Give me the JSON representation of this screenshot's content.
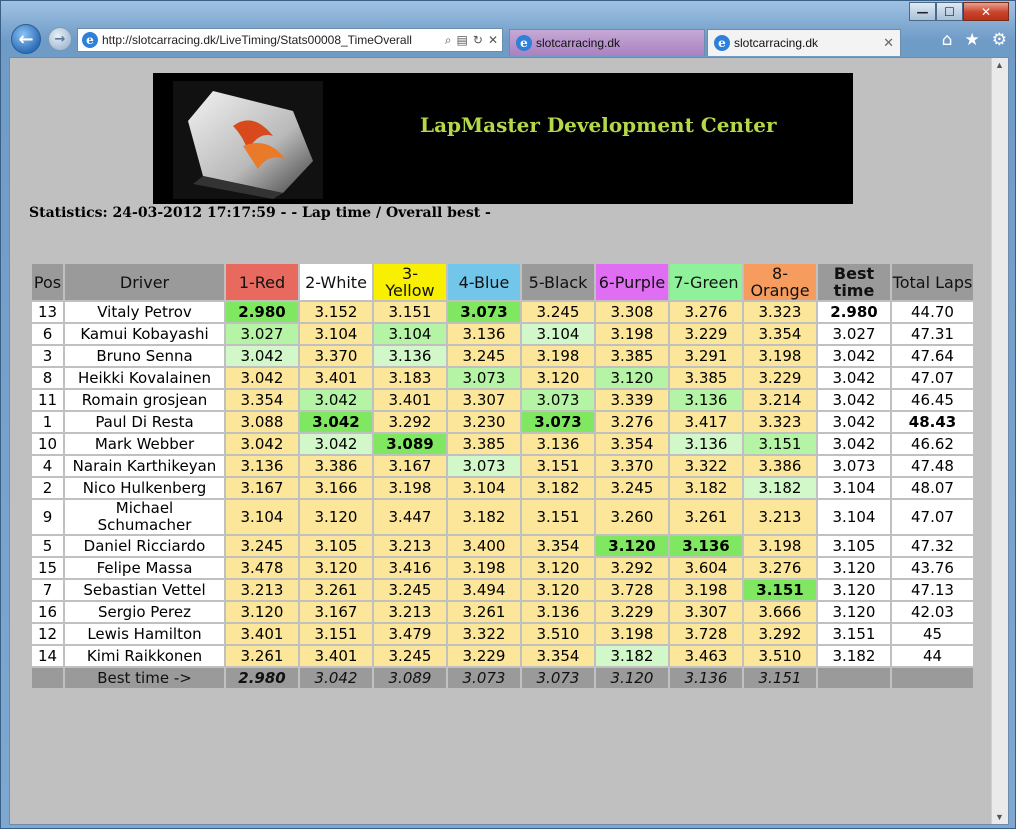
{
  "browser": {
    "url": "http://slotcarracing.dk/LiveTiming/Stats00008_TimeOverall",
    "tabs": [
      {
        "label": "slotcarracing.dk"
      },
      {
        "label": "slotcarracing.dk"
      }
    ],
    "window_buttons": {
      "minimize": "—",
      "maximize": "☐",
      "close": "✕"
    }
  },
  "banner": {
    "title": "LapMaster Development Center"
  },
  "stats_line": "Statistics: 24-03-2012 17:17:59 - - Lap time / Overall best -",
  "table": {
    "headers": {
      "pos": "Pos",
      "driver": "Driver",
      "lanes": [
        "1-Red",
        "2-White",
        "3-\nYellow",
        "4-Blue",
        "5-Black",
        "6-Purple",
        "7-Green",
        "8-\nOrange"
      ],
      "best": "Best time",
      "total": "Total Laps"
    },
    "lane_colors": [
      "#e86a5e",
      "#ffffff",
      "#f8f000",
      "#72c6ea",
      "#9a9a9a",
      "#e06ef2",
      "#8ff29a",
      "#f59c5e"
    ],
    "rows": [
      {
        "pos": "13",
        "driver": "Vitaly Petrov",
        "laps": [
          "2.980",
          "3.152",
          "3.151",
          "3.073",
          "3.245",
          "3.308",
          "3.276",
          "3.323"
        ],
        "cls": [
          "bg",
          "y",
          "y",
          "bg",
          "y",
          "y",
          "y",
          "y"
        ],
        "best": "2.980",
        "best_bold": true,
        "total": "44.70",
        "total_bold": false
      },
      {
        "pos": "6",
        "driver": "Kamui Kobayashi",
        "laps": [
          "3.027",
          "3.104",
          "3.104",
          "3.136",
          "3.104",
          "3.198",
          "3.229",
          "3.354"
        ],
        "cls": [
          "mg",
          "y",
          "mg",
          "y",
          "lg",
          "y",
          "y",
          "y"
        ],
        "best": "3.027",
        "best_bold": false,
        "total": "47.31",
        "total_bold": false
      },
      {
        "pos": "3",
        "driver": "Bruno Senna",
        "laps": [
          "3.042",
          "3.370",
          "3.136",
          "3.245",
          "3.198",
          "3.385",
          "3.291",
          "3.198"
        ],
        "cls": [
          "lg",
          "y",
          "lg",
          "y",
          "y",
          "y",
          "y",
          "y"
        ],
        "best": "3.042",
        "best_bold": false,
        "total": "47.64",
        "total_bold": false
      },
      {
        "pos": "8",
        "driver": "Heikki Kovalainen",
        "laps": [
          "3.042",
          "3.401",
          "3.183",
          "3.073",
          "3.120",
          "3.120",
          "3.385",
          "3.229"
        ],
        "cls": [
          "y",
          "y",
          "y",
          "mg",
          "y",
          "mg",
          "y",
          "y"
        ],
        "best": "3.042",
        "best_bold": false,
        "total": "47.07",
        "total_bold": false
      },
      {
        "pos": "11",
        "driver": "Romain grosjean",
        "laps": [
          "3.354",
          "3.042",
          "3.401",
          "3.307",
          "3.073",
          "3.339",
          "3.136",
          "3.214"
        ],
        "cls": [
          "y",
          "mg",
          "y",
          "y",
          "mg",
          "y",
          "mg",
          "y"
        ],
        "best": "3.042",
        "best_bold": false,
        "total": "46.45",
        "total_bold": false
      },
      {
        "pos": "1",
        "driver": "Paul Di Resta",
        "laps": [
          "3.088",
          "3.042",
          "3.292",
          "3.230",
          "3.073",
          "3.276",
          "3.417",
          "3.323"
        ],
        "cls": [
          "y",
          "bg",
          "y",
          "y",
          "bg",
          "y",
          "y",
          "y"
        ],
        "best": "3.042",
        "best_bold": false,
        "total": "48.43",
        "total_bold": true
      },
      {
        "pos": "10",
        "driver": "Mark Webber",
        "laps": [
          "3.042",
          "3.042",
          "3.089",
          "3.385",
          "3.136",
          "3.354",
          "3.136",
          "3.151"
        ],
        "cls": [
          "y",
          "lg",
          "bg",
          "y",
          "y",
          "y",
          "lg",
          "mg"
        ],
        "best": "3.042",
        "best_bold": false,
        "total": "46.62",
        "total_bold": false
      },
      {
        "pos": "4",
        "driver": "Narain Karthikeyan",
        "laps": [
          "3.136",
          "3.386",
          "3.167",
          "3.073",
          "3.151",
          "3.370",
          "3.322",
          "3.386"
        ],
        "cls": [
          "y",
          "y",
          "y",
          "lg",
          "y",
          "y",
          "y",
          "y"
        ],
        "best": "3.073",
        "best_bold": false,
        "total": "47.48",
        "total_bold": false
      },
      {
        "pos": "2",
        "driver": "Nico Hulkenberg",
        "laps": [
          "3.167",
          "3.166",
          "3.198",
          "3.104",
          "3.182",
          "3.245",
          "3.182",
          "3.182"
        ],
        "cls": [
          "y",
          "y",
          "y",
          "y",
          "y",
          "y",
          "y",
          "lg"
        ],
        "best": "3.104",
        "best_bold": false,
        "total": "48.07",
        "total_bold": false
      },
      {
        "pos": "9",
        "driver": "Michael\nSchumacher",
        "laps": [
          "3.104",
          "3.120",
          "3.447",
          "3.182",
          "3.151",
          "3.260",
          "3.261",
          "3.213"
        ],
        "cls": [
          "y",
          "y",
          "y",
          "y",
          "y",
          "y",
          "y",
          "y"
        ],
        "best": "3.104",
        "best_bold": false,
        "total": "47.07",
        "total_bold": false
      },
      {
        "pos": "5",
        "driver": "Daniel Ricciardo",
        "laps": [
          "3.245",
          "3.105",
          "3.213",
          "3.400",
          "3.354",
          "3.120",
          "3.136",
          "3.198"
        ],
        "cls": [
          "y",
          "y",
          "y",
          "y",
          "y",
          "bg",
          "bg",
          "y"
        ],
        "best": "3.105",
        "best_bold": false,
        "total": "47.32",
        "total_bold": false
      },
      {
        "pos": "15",
        "driver": "Felipe Massa",
        "laps": [
          "3.478",
          "3.120",
          "3.416",
          "3.198",
          "3.120",
          "3.292",
          "3.604",
          "3.276"
        ],
        "cls": [
          "y",
          "y",
          "y",
          "y",
          "y",
          "y",
          "y",
          "y"
        ],
        "best": "3.120",
        "best_bold": false,
        "total": "43.76",
        "total_bold": false
      },
      {
        "pos": "7",
        "driver": "Sebastian Vettel",
        "laps": [
          "3.213",
          "3.261",
          "3.245",
          "3.494",
          "3.120",
          "3.728",
          "3.198",
          "3.151"
        ],
        "cls": [
          "y",
          "y",
          "y",
          "y",
          "y",
          "y",
          "y",
          "bg"
        ],
        "best": "3.120",
        "best_bold": false,
        "total": "47.13",
        "total_bold": false
      },
      {
        "pos": "16",
        "driver": "Sergio Perez",
        "laps": [
          "3.120",
          "3.167",
          "3.213",
          "3.261",
          "3.136",
          "3.229",
          "3.307",
          "3.666"
        ],
        "cls": [
          "y",
          "y",
          "y",
          "y",
          "y",
          "y",
          "y",
          "y"
        ],
        "best": "3.120",
        "best_bold": false,
        "total": "42.03",
        "total_bold": false
      },
      {
        "pos": "12",
        "driver": "Lewis Hamilton",
        "laps": [
          "3.401",
          "3.151",
          "3.479",
          "3.322",
          "3.510",
          "3.198",
          "3.728",
          "3.292"
        ],
        "cls": [
          "y",
          "y",
          "y",
          "y",
          "y",
          "y",
          "y",
          "y"
        ],
        "best": "3.151",
        "best_bold": false,
        "total": "45",
        "total_bold": false
      },
      {
        "pos": "14",
        "driver": "Kimi Raikkonen",
        "laps": [
          "3.261",
          "3.401",
          "3.245",
          "3.229",
          "3.354",
          "3.182",
          "3.463",
          "3.510"
        ],
        "cls": [
          "y",
          "y",
          "y",
          "y",
          "y",
          "lg",
          "y",
          "y"
        ],
        "best": "3.182",
        "best_bold": false,
        "total": "44",
        "total_bold": false
      }
    ],
    "footer": {
      "label": "Best time ->",
      "values": [
        "2.980",
        "3.042",
        "3.089",
        "3.073",
        "3.073",
        "3.120",
        "3.136",
        "3.151"
      ]
    }
  }
}
